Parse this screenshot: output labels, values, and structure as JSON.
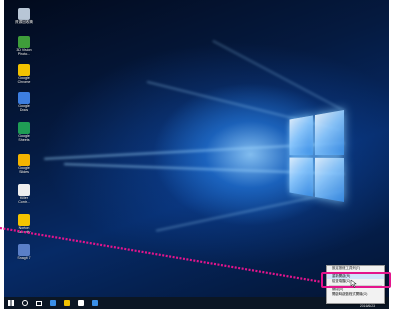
{
  "colors": {
    "highlight": "#e4148c",
    "taskbar": "#0b1624",
    "menu_bg": "#f2f2f2"
  },
  "desktop_icons": [
    {
      "id": "recycle-bin",
      "label": "資源回收筒",
      "color": "#b8c6d6",
      "icon": "recycle-bin-icon"
    },
    {
      "id": "3d-vision",
      "label": "3D Vision\nPhoto...",
      "color": "#3f9d3a",
      "icon": "3d-vision-icon"
    },
    {
      "id": "google-chrome",
      "label": "Google\nChrome",
      "color": "#f2c200",
      "icon": "chrome-icon"
    },
    {
      "id": "google-docs",
      "label": "Google\nDocs",
      "color": "#3d7ee0",
      "icon": "docs-icon"
    },
    {
      "id": "google-sheets",
      "label": "Google\nSheets",
      "color": "#1f9d55",
      "icon": "sheets-icon"
    },
    {
      "id": "google-slides",
      "label": "Google\nSlides",
      "color": "#f4b400",
      "icon": "slides-icon"
    },
    {
      "id": "killer-control",
      "label": "Killer\nContr...",
      "color": "#eeeeee",
      "icon": "killer-icon"
    },
    {
      "id": "norton-security",
      "label": "Norton\nSecurity",
      "color": "#f5c400",
      "icon": "norton-icon"
    },
    {
      "id": "snagit",
      "label": "Snagit 7",
      "color": "#5a7fc8",
      "icon": "snagit-icon"
    }
  ],
  "context_menu": {
    "items": [
      {
        "label": "設定按鈕工具列(T)",
        "highlighted": false
      },
      {
        "label": "重新開啟(R)",
        "highlighted": true
      },
      {
        "label": "檢查喚醒(C)",
        "highlighted": false
      },
      {
        "label": "關閉(X)",
        "highlighted": false
      },
      {
        "label": "開啟時啟動程式開機(O)",
        "highlighted": false
      }
    ]
  },
  "taskbar": {
    "items": [
      {
        "icon": "windows-start-icon",
        "color": "#ffffff"
      },
      {
        "icon": "search-icon",
        "color": "#ffffff"
      },
      {
        "icon": "task-view-icon",
        "color": "#ffffff"
      },
      {
        "icon": "edge-icon",
        "color": "#3a8fe8"
      },
      {
        "icon": "file-explorer-icon",
        "color": "#f2c200"
      },
      {
        "icon": "store-icon",
        "color": "#ffffff"
      },
      {
        "icon": "app-icon",
        "color": "#3a8fe8"
      }
    ],
    "clock_date": "2016/6/23"
  }
}
